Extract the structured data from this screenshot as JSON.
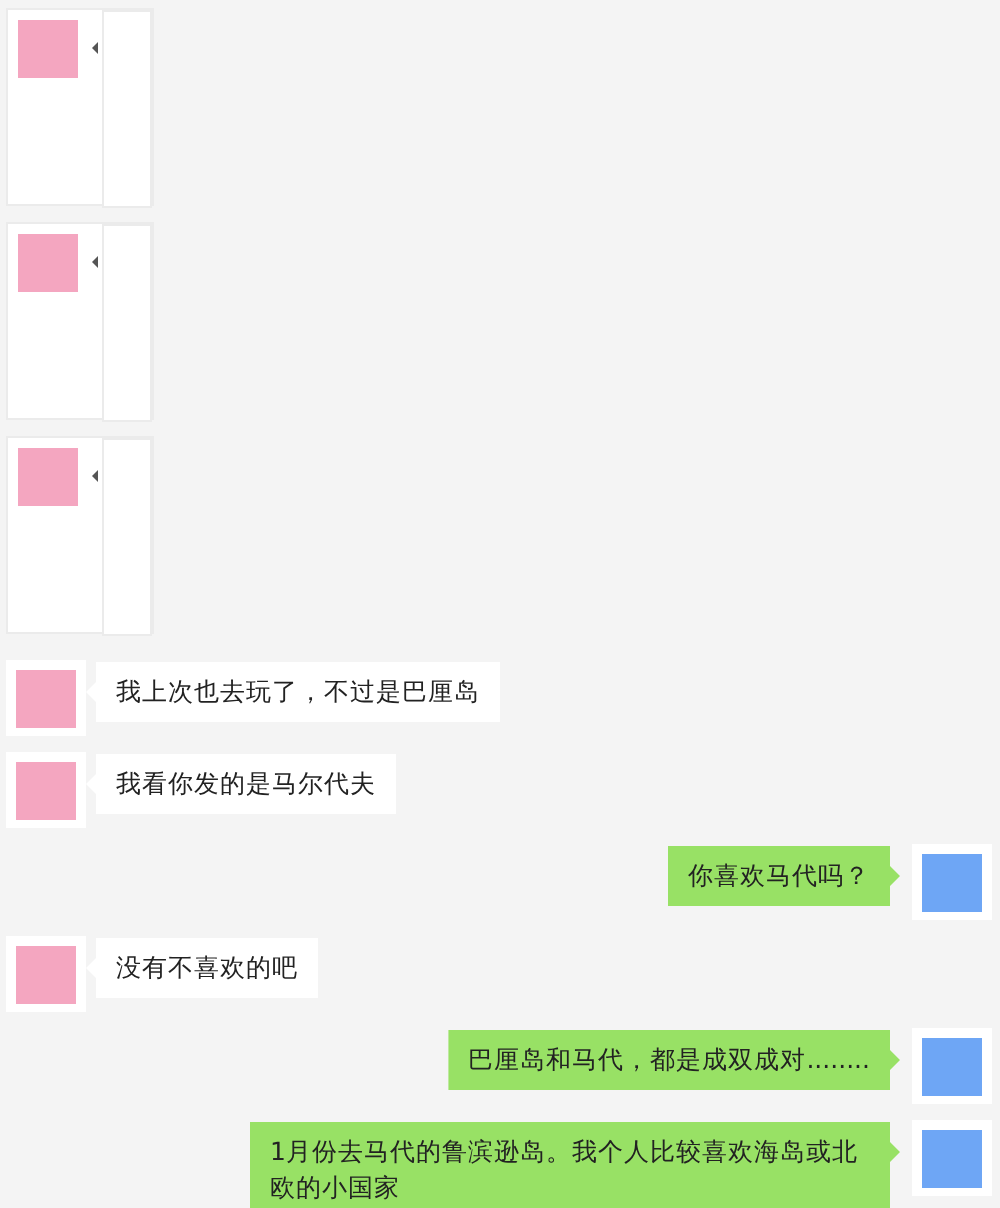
{
  "messages": [
    {
      "outgoing": false,
      "kind": "image"
    },
    {
      "outgoing": false,
      "kind": "image"
    },
    {
      "outgoing": false,
      "kind": "image"
    },
    {
      "outgoing": false,
      "kind": "text",
      "text": "我上次也去玩了，不过是巴厘岛"
    },
    {
      "outgoing": false,
      "kind": "text",
      "text": "我看你发的是马尔代夫"
    },
    {
      "outgoing": true,
      "kind": "text",
      "text": "你喜欢马代吗？"
    },
    {
      "outgoing": false,
      "kind": "text",
      "text": "没有不喜欢的吧"
    },
    {
      "outgoing": true,
      "kind": "text",
      "text": "巴厘岛和马代，都是成双成对........"
    },
    {
      "outgoing": true,
      "kind": "text",
      "text": "1月份去马代的鲁滨逊岛。我个人比较喜欢海岛或北欧的小国家"
    }
  ]
}
